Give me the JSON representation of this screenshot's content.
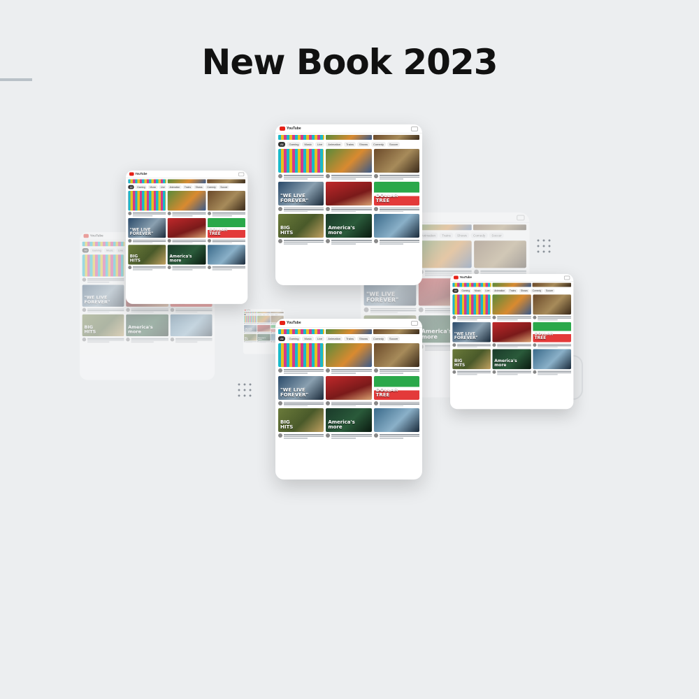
{
  "page": {
    "title": "New Book 2023",
    "background": "#eceef0"
  },
  "app": {
    "name": "YouTube",
    "accent": "#e62117"
  },
  "filter_chips": [
    "All",
    "Gaming",
    "Music",
    "Live",
    "Animation",
    "Trains",
    "Shows",
    "Comedy",
    "Soccer"
  ],
  "thumbnails": [
    {
      "style": "pencils",
      "text": "",
      "colors": [
        "#19b9c9",
        "#e8c020",
        "#d43a8a"
      ]
    },
    {
      "style": "cartoon",
      "text": "",
      "colors": [
        "#5a8a3a",
        "#d98a30",
        "#3a5a8a"
      ]
    },
    {
      "style": "food",
      "text": "",
      "colors": [
        "#6b4a2a",
        "#a78b5a",
        "#3a2a1a"
      ]
    },
    {
      "style": "statue",
      "text": "\"WE LIVE\nFOREVER\"",
      "colors": [
        "#2a4a6a",
        "#8aa0b0",
        "#1a2a3a"
      ]
    },
    {
      "style": "news",
      "text": "",
      "colors": [
        "#c0282a",
        "#7a1a1a",
        "#d8a070"
      ]
    },
    {
      "style": "dollar",
      "text": "DOLLAR\nTREE",
      "colors": [
        "#2aa84a",
        "#ffffff",
        "#e33a3a"
      ]
    },
    {
      "style": "sport",
      "text": "BIG\nHITS",
      "colors": [
        "#6a7a3a",
        "#4a5a2a",
        "#c0a060"
      ]
    },
    {
      "style": "map",
      "text": "America's\nmore",
      "colors": [
        "#1a3a2a",
        "#2a5a3a",
        "#0a1a10"
      ]
    },
    {
      "style": "car",
      "text": "",
      "colors": [
        "#3a6a8a",
        "#8ab0c8",
        "#1a2a3a"
      ]
    }
  ]
}
